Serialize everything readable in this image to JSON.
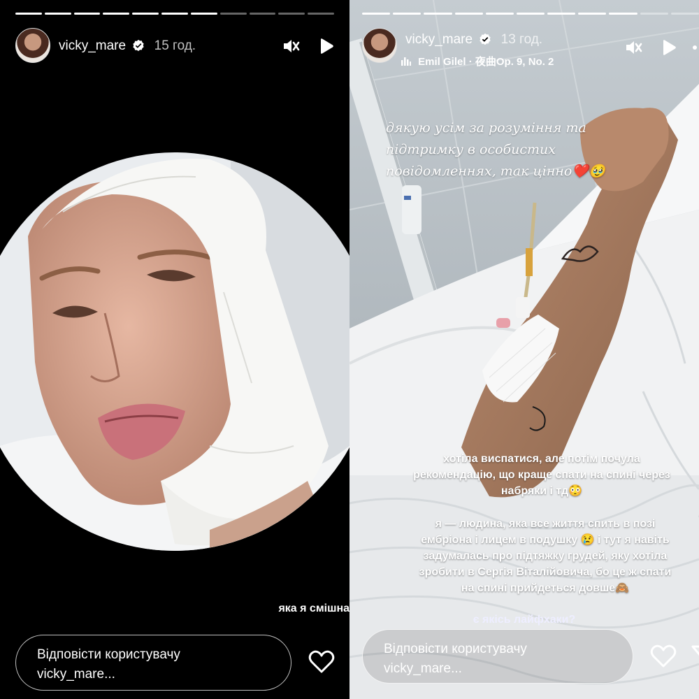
{
  "left_story": {
    "username": "vicky_mare",
    "time": "15 год.",
    "caption": "яка я смішна",
    "reply_placeholder_line1": "Відповісти користувачу",
    "reply_placeholder_line2": "vicky_mare...",
    "progress_segments_total": 11,
    "progress_segments_done": 7
  },
  "right_story": {
    "username": "vicky_mare",
    "time": "13 год.",
    "music": "Emil Gilel · 夜曲Op. 9, No. 2",
    "script_lines": [
      "дякую усім за розуміння та",
      "підтримку в особистих",
      "повідомленнях, так цінно❤️🥹"
    ],
    "paragraph1": [
      "хотіла виспатися, але потім почула",
      "рекомендацію, що краще спати на спині через",
      "набряки і тд😳"
    ],
    "paragraph2": [
      "я — людина, яка все життя спить в позі",
      "ембріона і лицем в подушку 😢 і тут я навіть",
      "задумалась про підтяжку грудей, яку хотіла",
      "зробити в Сергія Віталійовича, бо це ж спати",
      "на спині прийдеться довше🙈"
    ],
    "question": "є якісь лайфхаки?",
    "reply_placeholder_line1": "Відповісти користувачу",
    "reply_placeholder_line2": "vicky_mare...",
    "progress_segments_total": 11,
    "progress_segments_done": 9
  },
  "icons": {
    "mute": "speaker-muted-icon",
    "play": "play-icon",
    "more": "more-options-icon",
    "heart": "heart-icon",
    "verified": "verified-badge-icon",
    "music": "music-bars-icon"
  },
  "colors": {
    "verified": "#ffffff",
    "text": "#ffffff",
    "progress_done": "#ffffff",
    "progress_todo": "rgba(255,255,255,0.4)"
  }
}
